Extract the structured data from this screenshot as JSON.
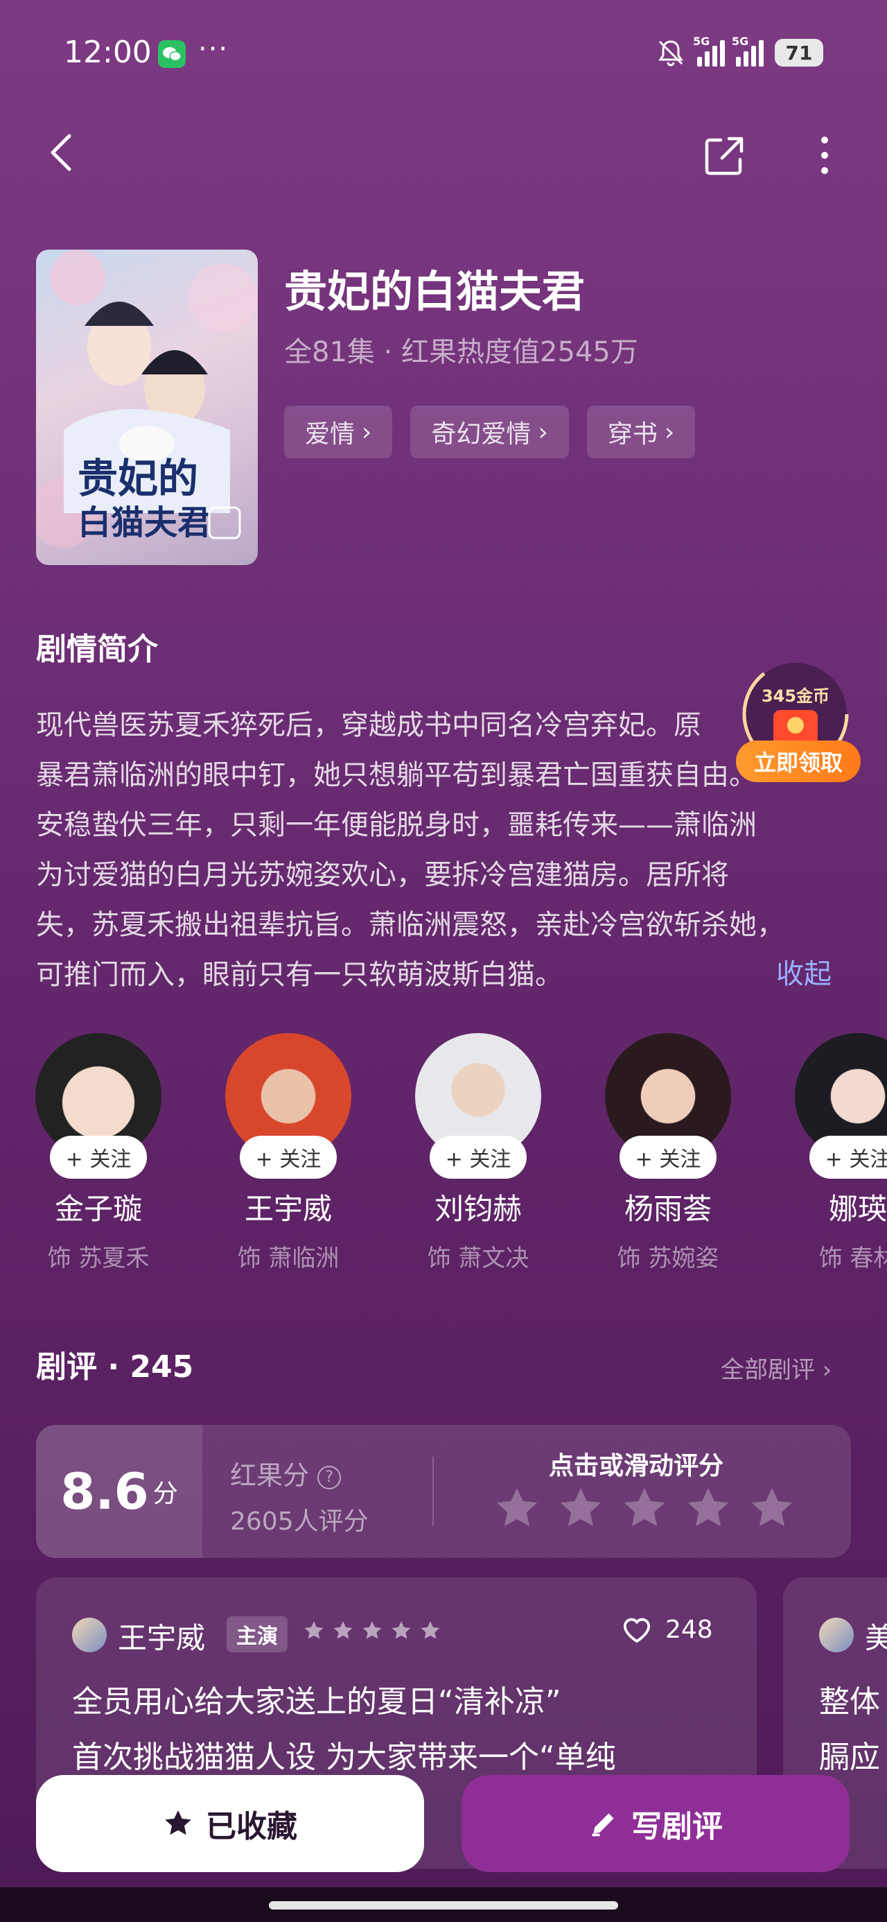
{
  "status": {
    "time": "12:00",
    "more_dots": "···",
    "net1": "5G",
    "net2": "5G",
    "battery": "71"
  },
  "show": {
    "title": "贵妃的白猫夫君",
    "subtitle": "全81集 · 红果热度值2545万",
    "tags": [
      "爱情",
      "奇幻爱情",
      "穿书"
    ]
  },
  "synopsis": {
    "heading": "剧情简介",
    "lines": [
      "现代兽医苏夏禾猝死后，穿越成书中同名冷宫弃妃。原",
      "暴君萧临洲的眼中钉，她只想躺平苟到暴君亡国重获自由。",
      "安稳蛰伏三年，只剩一年便能脱身时，噩耗传来——萧临洲",
      "为讨爱猫的白月光苏婉姿欢心，要拆冷宫建猫房。居所将",
      "失，苏夏禾搬出祖辈抗旨。萧临洲震怒，亲赴冷宫欲斩杀她，",
      "可推门而入，眼前只有一只软萌波斯白猫。"
    ],
    "collapse": "收起"
  },
  "reward": {
    "coins": "345金币",
    "claim": "立即领取"
  },
  "cast": [
    {
      "name": "金子璇",
      "role": "饰 苏夏禾",
      "follow": "+ 关注"
    },
    {
      "name": "王宇威",
      "role": "饰 萧临洲",
      "follow": "+ 关注"
    },
    {
      "name": "刘钧赫",
      "role": "饰 萧文决",
      "follow": "+ 关注"
    },
    {
      "name": "杨雨荟",
      "role": "饰 苏婉姿",
      "follow": "+ 关注"
    },
    {
      "name": "娜瑛",
      "role": "饰 春林",
      "follow": "+ 关注"
    }
  ],
  "reviews": {
    "heading": "剧评 · 245",
    "all": "全部剧评 ›",
    "score": "8.6",
    "score_unit": "分",
    "score_label": "红果分",
    "raters": "2605人评分",
    "rate_hint": "点击或滑动评分",
    "card1": {
      "user": "王宇威",
      "badge": "主演",
      "likes": "248",
      "lines": [
        "全员用心给大家送上的夏日“清补凉”",
        "首次挑战猫猫人设 为大家带来一个“单纯"
      ]
    },
    "card2": {
      "user": "美",
      "lines": [
        "整体",
        "膈应"
      ]
    }
  },
  "actions": {
    "favorite": "已收藏",
    "write": "写剧评"
  },
  "colors": {
    "bg_top": "#7d3a82",
    "bg_bottom": "#4f1a58",
    "accent": "#8e2e96",
    "link": "#9ab0ff",
    "reward": "#ff8a24"
  }
}
